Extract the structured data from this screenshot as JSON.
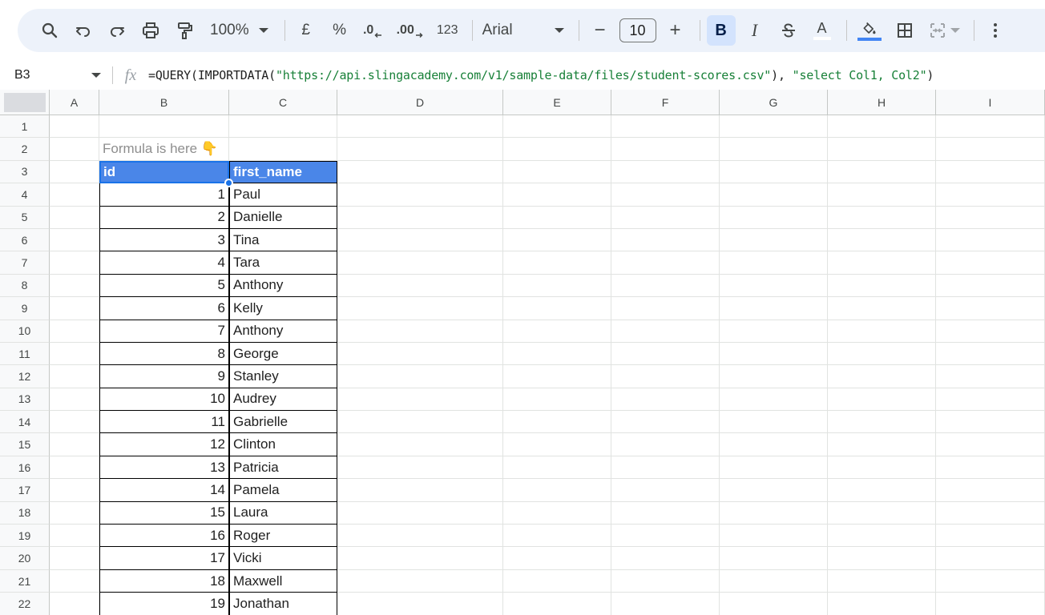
{
  "toolbar": {
    "zoom": "100%",
    "currency": "£",
    "percent": "%",
    "dec_decrease": ".0",
    "dec_increase": ".00",
    "number_format": "123",
    "font": "Arial",
    "font_size": "10",
    "minus": "−",
    "plus": "+",
    "bold": "B",
    "italic": "I",
    "text_color": "A",
    "text_color_value": "#ffffff",
    "fill_color_value": "#4285f4"
  },
  "formula_bar": {
    "cell_ref": "B3",
    "fx": "fx",
    "formula_prefix": "=QUERY(IMPORTDATA(",
    "formula_url": "\"https://api.slingacademy.com/v1/sample-data/files/student-scores.csv\"",
    "formula_middle": "), ",
    "formula_query": "\"select Col1, Col2\"",
    "formula_suffix": ")"
  },
  "columns": [
    "A",
    "B",
    "C",
    "D",
    "E",
    "F",
    "G",
    "H",
    "I"
  ],
  "note": "Formula is here 👇",
  "header": {
    "id": "id",
    "first_name": "first_name"
  },
  "header_color": "#4a86e8",
  "rows": [
    {
      "row": "4",
      "id": "1",
      "name": "Paul"
    },
    {
      "row": "5",
      "id": "2",
      "name": "Danielle"
    },
    {
      "row": "6",
      "id": "3",
      "name": "Tina"
    },
    {
      "row": "7",
      "id": "4",
      "name": "Tara"
    },
    {
      "row": "8",
      "id": "5",
      "name": "Anthony"
    },
    {
      "row": "9",
      "id": "6",
      "name": "Kelly"
    },
    {
      "row": "10",
      "id": "7",
      "name": "Anthony"
    },
    {
      "row": "11",
      "id": "8",
      "name": "George"
    },
    {
      "row": "12",
      "id": "9",
      "name": "Stanley"
    },
    {
      "row": "13",
      "id": "10",
      "name": "Audrey"
    },
    {
      "row": "14",
      "id": "11",
      "name": "Gabrielle"
    },
    {
      "row": "15",
      "id": "12",
      "name": "Clinton"
    },
    {
      "row": "16",
      "id": "13",
      "name": "Patricia"
    },
    {
      "row": "17",
      "id": "14",
      "name": "Pamela"
    },
    {
      "row": "18",
      "id": "15",
      "name": "Laura"
    },
    {
      "row": "19",
      "id": "16",
      "name": "Roger"
    },
    {
      "row": "20",
      "id": "17",
      "name": "Vicki"
    },
    {
      "row": "21",
      "id": "18",
      "name": "Maxwell"
    },
    {
      "row": "22",
      "id": "19",
      "name": "Jonathan"
    }
  ],
  "row_labels": [
    "1",
    "2",
    "3"
  ]
}
